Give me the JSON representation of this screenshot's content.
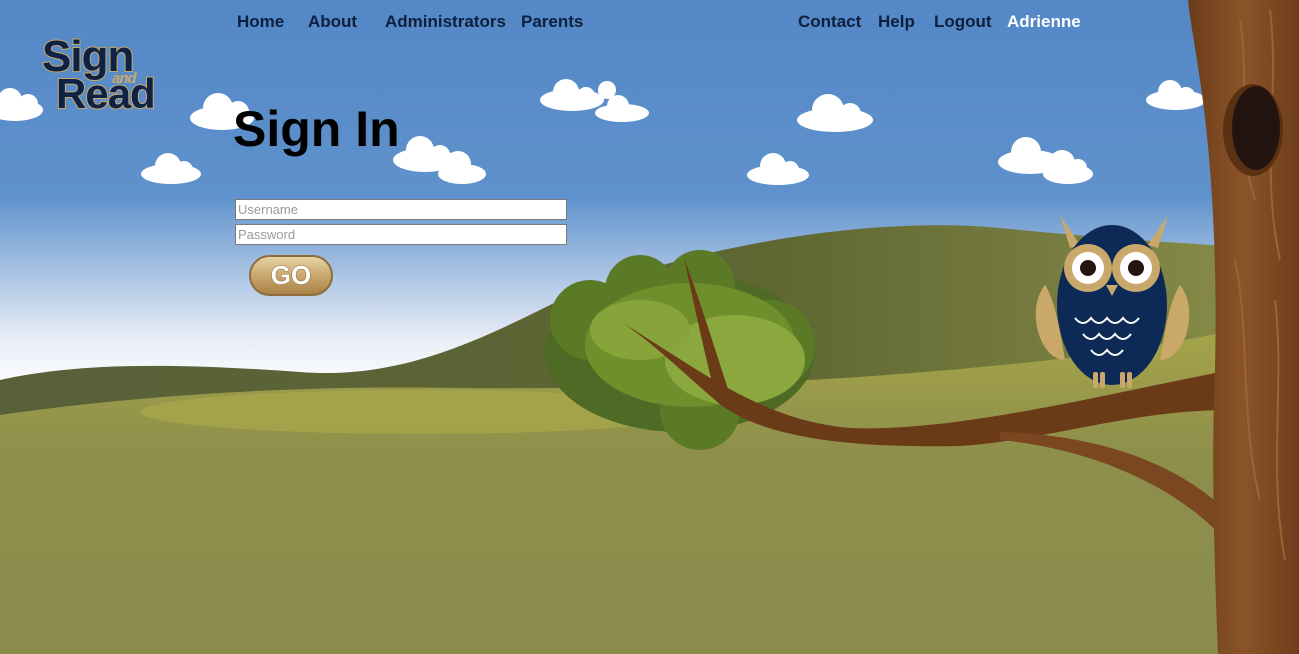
{
  "nav": {
    "home": "Home",
    "about": "About",
    "administrators": "Administrators",
    "parents": "Parents",
    "contact": "Contact",
    "help": "Help",
    "logout": "Logout",
    "user": "Adrienne"
  },
  "logo": {
    "sign": "Sign",
    "and": "and",
    "read": "Read"
  },
  "signin": {
    "title": "Sign In",
    "username_placeholder": "Username",
    "password_placeholder": "Password",
    "go_label": "GO"
  },
  "colors": {
    "sky": "#5387c6",
    "hill_dark": "#5a6234",
    "hill_light": "#8a8d4c",
    "trunk": "#7a4a22",
    "owl_body": "#0d2a57",
    "owl_tan": "#c9a86a",
    "nav_text": "#0e1f3d",
    "nav_active": "#ffffff"
  }
}
